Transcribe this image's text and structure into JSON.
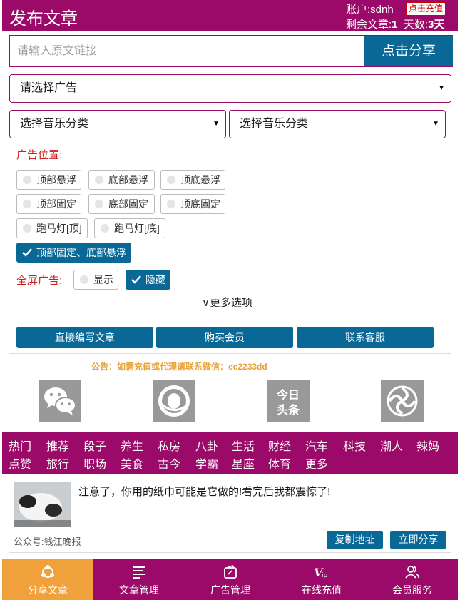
{
  "header": {
    "title": "发布文章",
    "account_label": "账户:",
    "account_name": "sdnh",
    "recharge_button": "点击充值",
    "remaining_label": "剩余文章:",
    "remaining_count": "1",
    "days_label": "天数:",
    "days_value": "3天"
  },
  "link_input": {
    "placeholder": "请输入原文链接",
    "value": ""
  },
  "share_button": "点击分享",
  "ad_select": {
    "selected": "请选择广告"
  },
  "music_selects": [
    {
      "selected": "选择音乐分类"
    },
    {
      "selected": "选择音乐分类"
    }
  ],
  "ad_position": {
    "label": "广告位置:",
    "options": [
      {
        "label": "顶部悬浮",
        "checked": false
      },
      {
        "label": "底部悬浮",
        "checked": false
      },
      {
        "label": "顶底悬浮",
        "checked": false
      },
      {
        "label": "顶部固定",
        "checked": false
      },
      {
        "label": "底部固定",
        "checked": false
      },
      {
        "label": "顶底固定",
        "checked": false
      },
      {
        "label": "跑马灯[顶]",
        "checked": false
      },
      {
        "label": "跑马灯[底]",
        "checked": false
      },
      {
        "label": "顶部固定、底部悬浮",
        "checked": true
      }
    ]
  },
  "fullscreen_ad": {
    "label": "全屏广告:",
    "options": [
      {
        "label": "显示",
        "checked": false
      },
      {
        "label": "隐藏",
        "checked": true
      }
    ]
  },
  "more_options": "∨更多选项",
  "action_buttons": [
    "直接编写文章",
    "购买会员",
    "联系客服"
  ],
  "notice": "公告：如需充值或代理请联系微信：cc2233dd",
  "platforms": [
    "wechat-icon",
    "qq-icon",
    "toutiao-icon",
    "qzone-icon"
  ],
  "toutiao_text": "今日头条",
  "categories": [
    "热门",
    "推荐",
    "段子",
    "养生",
    "私房",
    "八卦",
    "生活",
    "财经",
    "汽车",
    "科技",
    "潮人",
    "辣妈",
    "点赞",
    "旅行",
    "职场",
    "美食",
    "古今",
    "学霸",
    "星座",
    "体育",
    "更多"
  ],
  "article": {
    "title": "注意了，你用的纸巾可能是它做的!看完后我都震惊了!",
    "source": "公众号:钱江晚报",
    "copy_button": "复制地址",
    "share_button": "立即分享"
  },
  "bottom_nav": [
    {
      "label": "分享文章",
      "icon": "share-icon",
      "active": true
    },
    {
      "label": "文章管理",
      "icon": "list-icon",
      "active": false
    },
    {
      "label": "广告管理",
      "icon": "ad-icon",
      "active": false
    },
    {
      "label": "在线充值",
      "icon": "vip-icon",
      "active": false
    },
    {
      "label": "会员服务",
      "icon": "user-icon",
      "active": false
    }
  ],
  "colors": {
    "brand": "#9b0a68",
    "primary": "#0a6896",
    "accent": "#f0a13b",
    "warning": "#d01d1d"
  }
}
